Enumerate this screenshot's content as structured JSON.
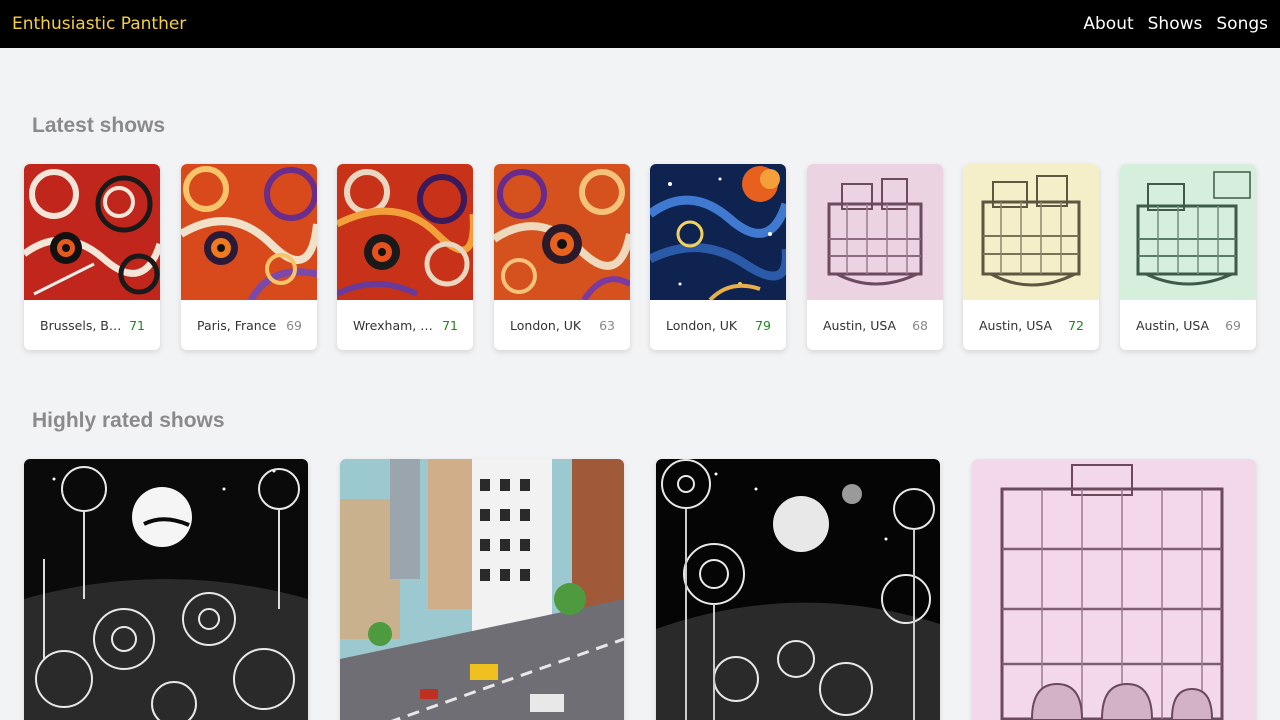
{
  "nav": {
    "brand": "Enthusiastic Panther",
    "links": [
      "About",
      "Shows",
      "Songs"
    ]
  },
  "sections": {
    "latest_title": "Latest shows",
    "rated_title": "Highly rated shows"
  },
  "latest_shows": [
    {
      "location": "Brussels, Be...",
      "score": "71",
      "high": true,
      "art": "red-swirl-art"
    },
    {
      "location": "Paris, France",
      "score": "69",
      "high": false,
      "art": "orange-swirl-art"
    },
    {
      "location": "Wrexham, UK",
      "score": "71",
      "high": true,
      "art": "red-swirl-art"
    },
    {
      "location": "London, UK",
      "score": "63",
      "high": false,
      "art": "orange-swirl-art"
    },
    {
      "location": "London, UK",
      "score": "79",
      "high": true,
      "art": "blue-swirl-art"
    },
    {
      "location": "Austin, USA",
      "score": "68",
      "high": false,
      "art": "pink-castle-art"
    },
    {
      "location": "Austin, USA",
      "score": "72",
      "high": true,
      "art": "yellow-castle-art"
    },
    {
      "location": "Austin, USA",
      "score": "69",
      "high": false,
      "art": "green-castle-art"
    }
  ],
  "rated_shows": [
    {
      "art": "flower-night-art"
    },
    {
      "art": "city-street-art"
    },
    {
      "art": "sunflower-moon-art"
    },
    {
      "art": "pink-castle-art"
    }
  ],
  "colors": {
    "brand": "#f4d03f",
    "high_score": "#1a8a1a",
    "low_score": "#888888"
  }
}
